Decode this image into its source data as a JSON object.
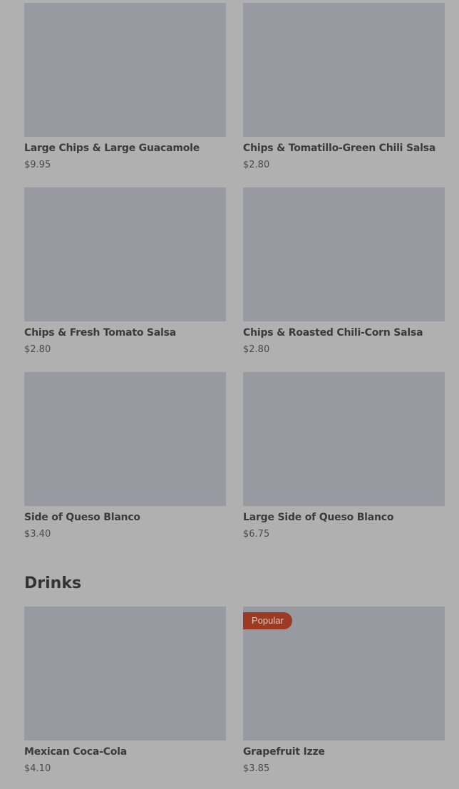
{
  "menu_top": [
    {
      "name": "Large Chips & Large Guacamole",
      "price": "$9.95"
    },
    {
      "name": "Chips & Tomatillo-Green Chili Salsa",
      "price": "$2.80"
    },
    {
      "name": "Chips & Fresh Tomato Salsa",
      "price": "$2.80"
    },
    {
      "name": "Chips & Roasted Chili-Corn Salsa",
      "price": "$2.80"
    },
    {
      "name": "Side of Queso Blanco",
      "price": "$3.40"
    },
    {
      "name": "Large Side of Queso Blanco",
      "price": "$6.75"
    }
  ],
  "drinks": {
    "title": "Drinks",
    "items": [
      {
        "name": "Mexican Coca-Cola",
        "price": "$4.10"
      },
      {
        "name": "Grapefruit Izze",
        "price": "$3.85",
        "badge": "Popular"
      }
    ]
  },
  "colors": {
    "background": "#b0b0b0",
    "image_placeholder": "#979aa1",
    "badge": "#9c3a24"
  }
}
